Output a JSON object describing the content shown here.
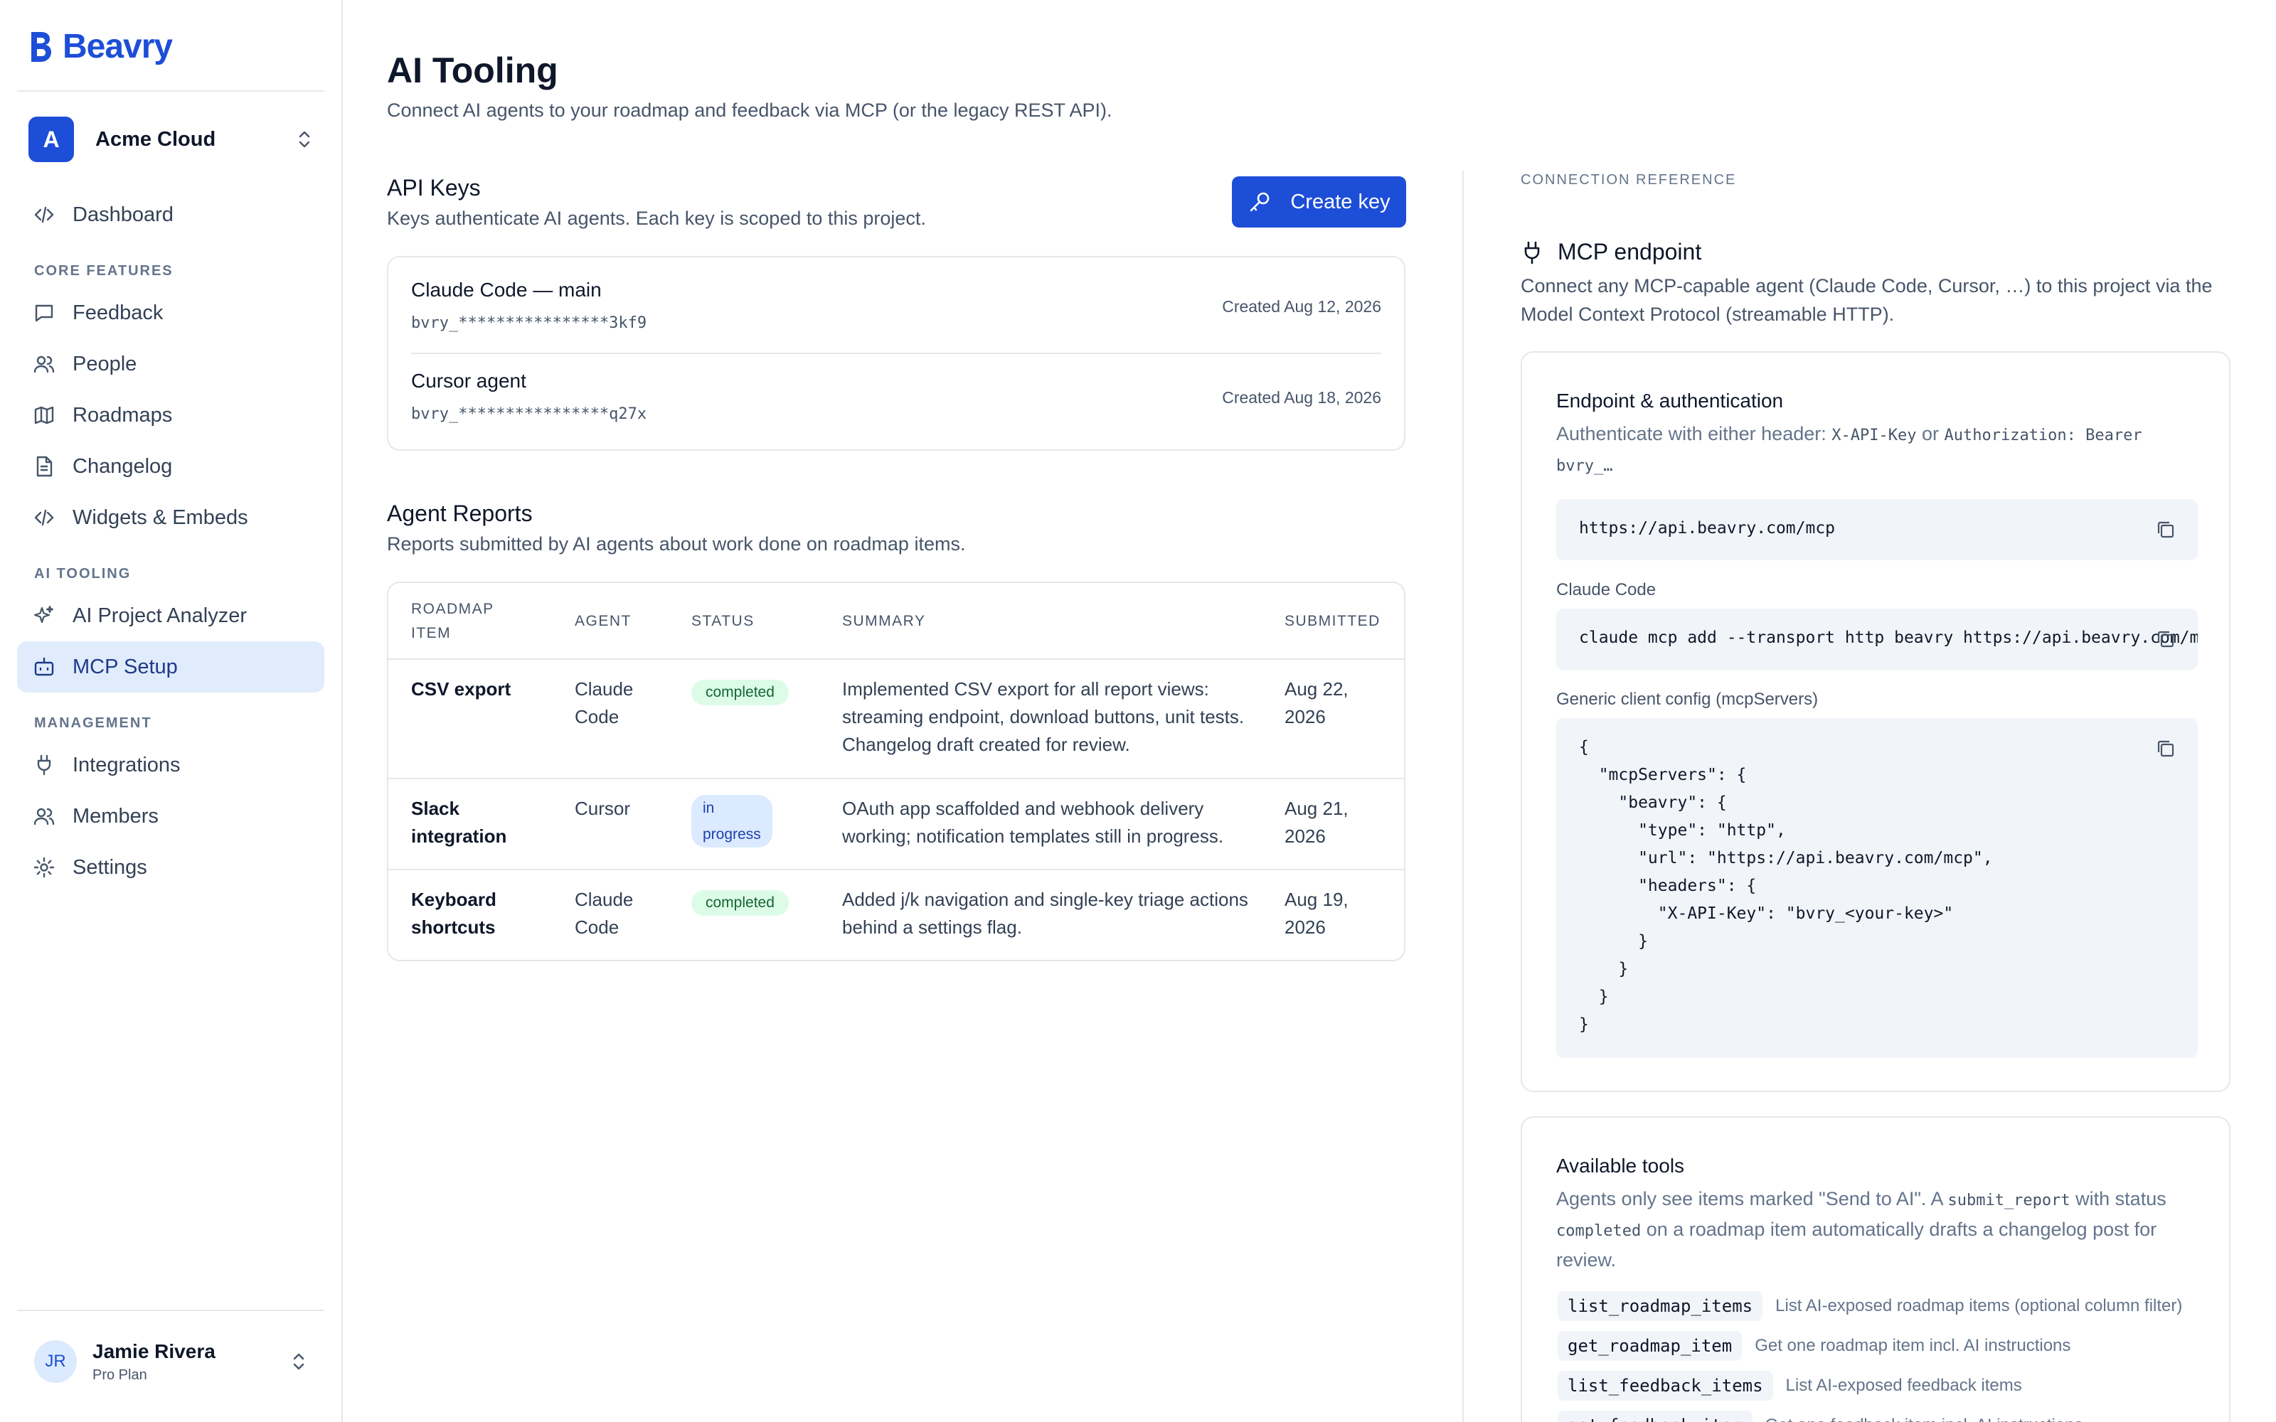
{
  "app": {
    "name": "Beavry"
  },
  "workspace": {
    "initial": "A",
    "name": "Acme Cloud"
  },
  "nav": {
    "dashboard": "Dashboard",
    "sections": {
      "core": "CORE FEATURES",
      "ai": "AI TOOLING",
      "management": "MANAGEMENT"
    },
    "core": [
      "Feedback",
      "People",
      "Roadmaps",
      "Changelog",
      "Widgets & Embeds"
    ],
    "ai": [
      "AI Project Analyzer",
      "MCP Setup"
    ],
    "management": [
      "Integrations",
      "Members",
      "Settings"
    ]
  },
  "user": {
    "initials": "JR",
    "name": "Jamie Rivera",
    "plan": "Pro Plan"
  },
  "page": {
    "title": "AI Tooling",
    "subtitle": "Connect AI agents to your roadmap and feedback via MCP (or the legacy REST API)."
  },
  "api_keys": {
    "title": "API Keys",
    "subtitle": "Keys authenticate AI agents. Each key is scoped to this project.",
    "create_label": "Create key",
    "keys": [
      {
        "name": "Claude Code — main",
        "masked": "bvry_****************3kf9",
        "created": "Created Aug 12, 2026"
      },
      {
        "name": "Cursor agent",
        "masked": "bvry_****************q27x",
        "created": "Created Aug 18, 2026"
      }
    ]
  },
  "reports": {
    "title": "Agent Reports",
    "subtitle": "Reports submitted by AI agents about work done on roadmap items.",
    "columns": {
      "item": "ROADMAP ITEM",
      "agent": "AGENT",
      "status": "STATUS",
      "summary": "SUMMARY",
      "submitted": "SUBMITTED"
    },
    "rows": [
      {
        "item": "CSV export",
        "agent": "Claude Code",
        "status": "completed",
        "summary": "Implemented CSV export for all report views: streaming endpoint, download buttons, unit tests. Changelog draft created for review.",
        "submitted": "Aug 22, 2026"
      },
      {
        "item": "Slack integration",
        "agent": "Cursor",
        "status": "in progress",
        "summary": "OAuth app scaffolded and webhook delivery working; notification templates still in progress.",
        "submitted": "Aug 21, 2026"
      },
      {
        "item": "Keyboard shortcuts",
        "agent": "Claude Code",
        "status": "completed",
        "summary": "Added j/k navigation and single-key triage actions behind a settings flag.",
        "submitted": "Aug 19, 2026"
      }
    ]
  },
  "reference": {
    "label": "CONNECTION REFERENCE",
    "mcp_title": "MCP endpoint",
    "mcp_desc": "Connect any MCP-capable agent (Claude Code, Cursor, …) to this project via the Model Context Protocol (streamable HTTP).",
    "auth": {
      "title": "Endpoint & authentication",
      "desc_prefix": "Authenticate with either header: ",
      "header1": "X-API-Key",
      "desc_or": " or ",
      "header2": "Authorization: Bearer bvry_…",
      "url": "https://api.beavry.com/mcp",
      "claude_label": "Claude Code",
      "claude_cmd": "claude mcp add --transport http beavry https://api.beavry.com/mcp",
      "generic_label": "Generic client config (mcpServers)",
      "config": "{\n  \"mcpServers\": {\n    \"beavry\": {\n      \"type\": \"http\",\n      \"url\": \"https://api.beavry.com/mcp\",\n      \"headers\": {\n        \"X-API-Key\": \"bvry_<your-key>\"\n      }\n    }\n  }\n}"
    },
    "tools": {
      "title": "Available tools",
      "desc_a": "Agents only see items marked \"Send to AI\". A ",
      "code_a": "submit_report",
      "desc_b": " with status ",
      "code_b": "completed",
      "desc_c": " on a roadmap item automatically drafts a changelog post for review.",
      "list": [
        {
          "name": "list_roadmap_items",
          "desc": "List AI-exposed roadmap items (optional column filter)"
        },
        {
          "name": "get_roadmap_item",
          "desc": "Get one roadmap item incl. AI instructions"
        },
        {
          "name": "list_feedback_items",
          "desc": "List AI-exposed feedback items"
        },
        {
          "name": "get_feedback_item",
          "desc": "Get one feedback item incl. AI instructions"
        }
      ]
    }
  },
  "colors": {
    "accent": "#1d4ed8",
    "active_bg": "#e0ecfb",
    "completed": "#dcfce7",
    "in_progress": "#dbeafe"
  }
}
